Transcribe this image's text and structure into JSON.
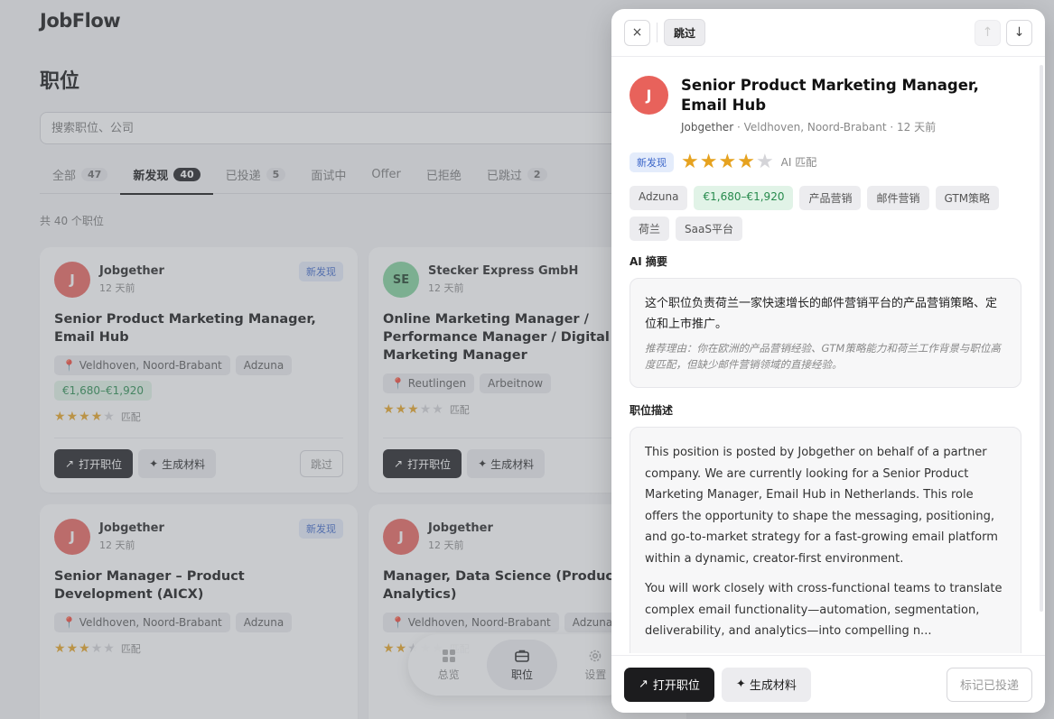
{
  "app": {
    "logo": "JobFlow",
    "page_title": "职位",
    "search_placeholder": "搜索职位、公司"
  },
  "tabs": [
    {
      "label": "全部",
      "count": "47"
    },
    {
      "label": "新发现",
      "count": "40"
    },
    {
      "label": "已投递",
      "count": "5"
    },
    {
      "label": "面试中",
      "count": ""
    },
    {
      "label": "Offer",
      "count": ""
    },
    {
      "label": "已拒绝",
      "count": ""
    },
    {
      "label": "已跳过",
      "count": "2"
    }
  ],
  "count_text": "共 40 个职位",
  "common": {
    "new_badge": "新发现",
    "match": "匹配",
    "open": "打开职位",
    "generate": "生成材料",
    "skip": "跳过",
    "pin": "📍"
  },
  "cards": [
    {
      "initial": "J",
      "company": "Jobgether",
      "time": "12 天前",
      "title": "Senior Product Marketing Manager, Email Hub",
      "location": "Veldhoven, Noord-Brabant",
      "source": "Adzuna",
      "salary": "€1,680–€1,920",
      "rating": 4
    },
    {
      "initial": "SE",
      "company": "Stecker Express GmbH",
      "time": "12 天前",
      "title": "Online Marketing Manager / Performance Manager / Digital Marketing Manager",
      "location": "Reutlingen",
      "source": "Arbeitnow",
      "rating": 3
    },
    {
      "initial": "J",
      "company": "Jobgether",
      "time": "12 天前",
      "title": "Senior Manager – Product Development (AICX)",
      "location": "Veldhoven, Noord-Brabant",
      "source": "Adzuna",
      "rating": 3
    },
    {
      "initial": "J",
      "company": "Jobgether",
      "time": "12 天前",
      "title": "Manager, Data Science (Product Analytics)",
      "location": "Veldhoven, Noord-Brabant",
      "source": "Adzuna",
      "rating": 2
    }
  ],
  "bottom_nav": {
    "overview": "总览",
    "jobs": "职位",
    "settings": "设置"
  },
  "drawer": {
    "skip_label": "跳过",
    "close_icon": "×",
    "initial": "J",
    "title": "Senior Product Marketing Manager, Email Hub",
    "company": "Jobgether",
    "location": "Veldhoven, Noord-Brabant",
    "time": "12 天前",
    "status": "新发现",
    "rating": 4,
    "ai_match": "AI 匹配",
    "tags": [
      {
        "label": "Adzuna",
        "type": "plain"
      },
      {
        "label": "€1,680–€1,920",
        "type": "salary"
      },
      {
        "label": "产品营销",
        "type": "plain"
      },
      {
        "label": "邮件营销",
        "type": "plain"
      },
      {
        "label": "GTM策略",
        "type": "plain"
      },
      {
        "label": "荷兰",
        "type": "plain"
      },
      {
        "label": "SaaS平台",
        "type": "plain"
      }
    ],
    "summary_title": "AI 摘要",
    "summary": "这个职位负责荷兰一家快速增长的邮件营销平台的产品营销策略、定位和上市推广。",
    "reason": "推荐理由：你在欧洲的产品营销经验、GTM策略能力和荷兰工作背景与职位高度匹配，但缺少邮件营销领域的直接经验。",
    "desc_title": "职位描述",
    "desc_p1": "This position is posted by Jobgether on behalf of a partner company. We are currently looking for a Senior Product Marketing Manager, Email Hub in Netherlands. This role offers the opportunity to shape the messaging, positioning, and go-to-market strategy for a fast-growing email platform within a dynamic, creator-first environment.",
    "desc_p2": "You will work closely with cross-functional teams to translate complex email functionality—automation, segmentation, deliverability, and analytics—into compelling n...",
    "open_label": "打开职位",
    "generate_label": "生成材料",
    "mark_applied": "标记已投递"
  }
}
